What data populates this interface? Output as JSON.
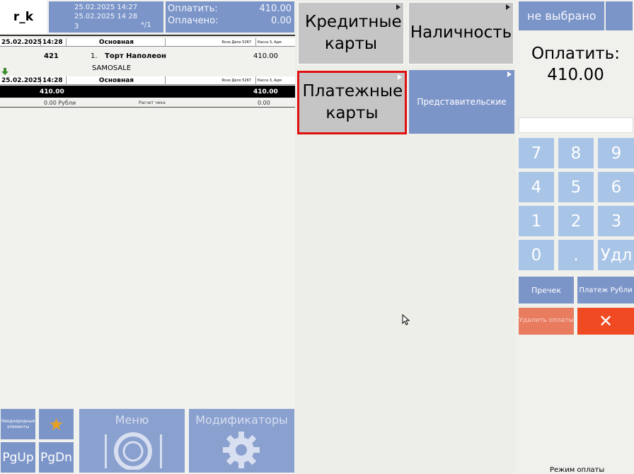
{
  "header": {
    "user": "r_k",
    "info_line1": "25.02.2025 14:27",
    "info_line2": "25.02.2025 14 28",
    "info_guests": "3",
    "info_table": "*/1",
    "pay_label": "Оплатить:",
    "pay_value": "410.00",
    "paid_label": "Оплачено:",
    "paid_value": "0.00"
  },
  "order": {
    "block1": {
      "date": "25.02.2025",
      "time": "14:28",
      "type": "Основная",
      "meta1": "Ясно Дело 5267",
      "meta2": "Касса 3, Адм"
    },
    "item": {
      "code": "421",
      "index": "1.",
      "name": "Торт Наполеон",
      "price": "410.00",
      "modifier": "SAMOSALE"
    },
    "block2": {
      "date": "25.02.2025",
      "time": "14:28",
      "type": "Основная",
      "meta1": "Ясно Дело 5267",
      "meta2": "Касса 3, Адм"
    },
    "total_left": "410.00",
    "total_right": "410.00",
    "calc_left": "0.00 Рубли",
    "calc_mid": "Расчет чека",
    "calc_right": "0.00"
  },
  "bottom": {
    "guest_button": "Неоднородные элементы",
    "menu": "Меню",
    "modifiers": "Модификаторы",
    "pgup": "PgUp",
    "pgdn": "PgDn"
  },
  "payment": {
    "credit_cards": "Кредитные карты",
    "cash": "Наличность",
    "payment_cards": "Платежные карты",
    "representative": "Представительские"
  },
  "right": {
    "not_selected": "не выбрано",
    "pay_label": "Оплатить:",
    "pay_amount": "410.00",
    "keys": [
      "7",
      "8",
      "9",
      "4",
      "5",
      "6",
      "1",
      "2",
      "3",
      "0",
      ".",
      "Удл"
    ],
    "precheck": "Пречек",
    "payment_rub": "Платеж Рубли",
    "delete_payments": "Удалить оплаты",
    "close": "✕",
    "mode": "Режим оплаты"
  },
  "colors": {
    "accent_blue": "#7c95c9",
    "key_blue": "#a8c4e6",
    "cancel_red": "#f04a22",
    "highlight": "#e01010"
  }
}
